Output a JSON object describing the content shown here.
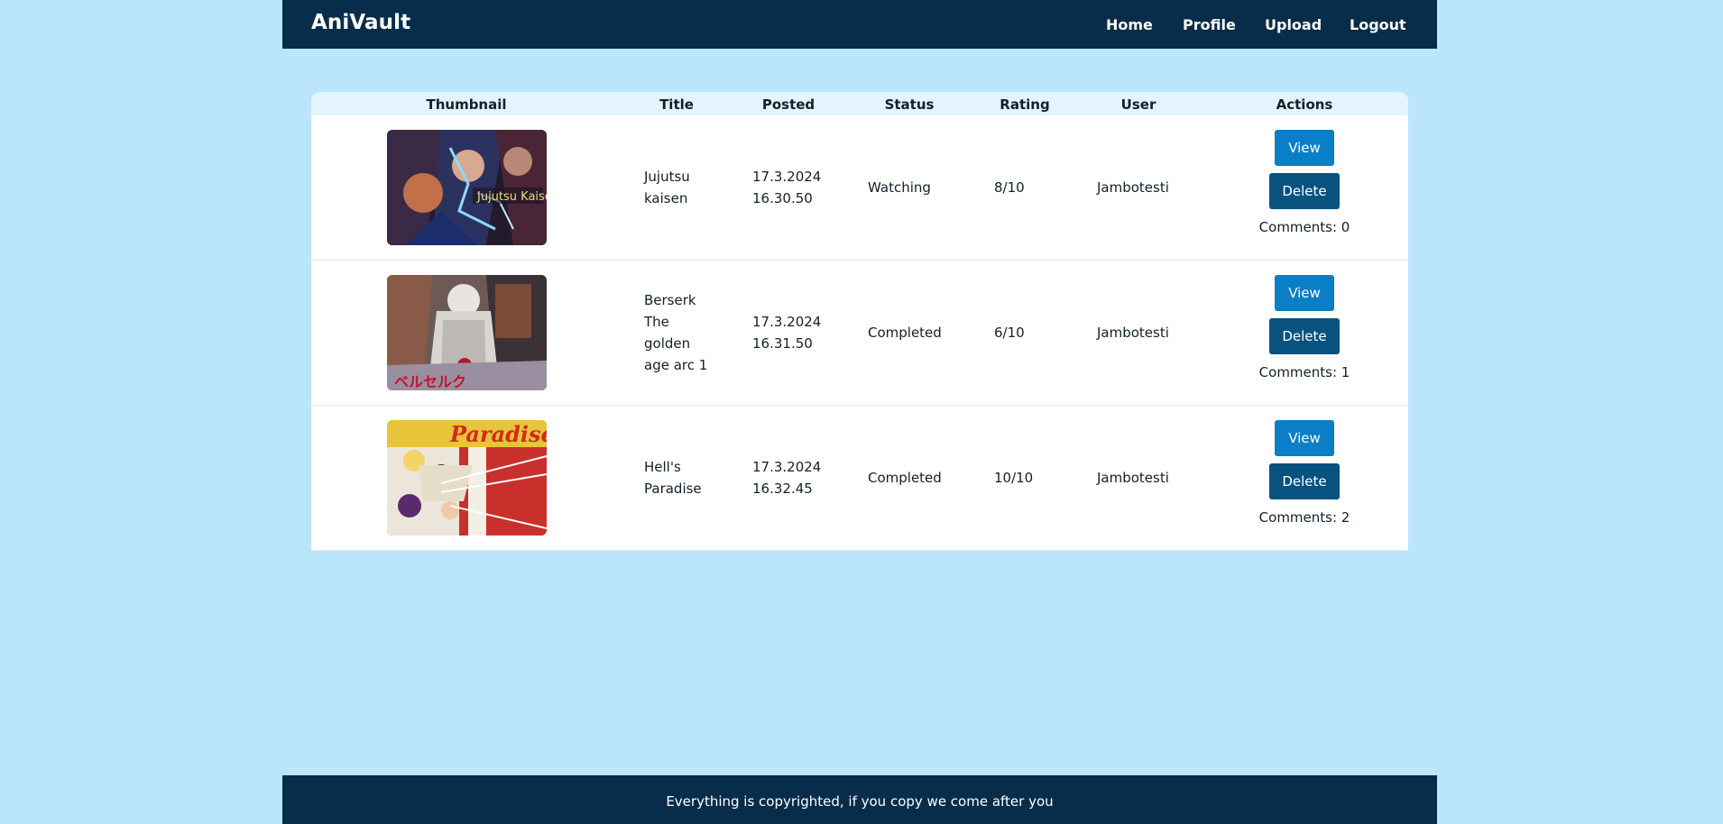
{
  "app": {
    "brand": "AniVault"
  },
  "nav": {
    "home": "Home",
    "profile": "Profile",
    "upload": "Upload",
    "logout": "Logout"
  },
  "table": {
    "headers": [
      "Thumbnail",
      "Title",
      "Posted",
      "Status",
      "Rating",
      "User",
      "Actions"
    ],
    "rows": [
      {
        "title_lines": [
          "Jujutsu",
          "kaisen"
        ],
        "posted_lines": [
          "17.3.2024",
          "16.30.50"
        ],
        "status": "Watching",
        "rating": "8/10",
        "user": "Jambotesti",
        "view_label": "View",
        "delete_label": "Delete",
        "comments": "Comments: 0"
      },
      {
        "title_lines": [
          "Berserk",
          "The",
          "golden",
          "age arc 1"
        ],
        "posted_lines": [
          "17.3.2024",
          "16.31.50"
        ],
        "status": "Completed",
        "rating": "6/10",
        "user": "Jambotesti",
        "view_label": "View",
        "delete_label": "Delete",
        "comments": "Comments: 1"
      },
      {
        "title_lines": [
          "Hell's",
          "Paradise"
        ],
        "posted_lines": [
          "17.3.2024",
          "16.32.45"
        ],
        "status": "Completed",
        "rating": "10/10",
        "user": "Jambotesti",
        "view_label": "View",
        "delete_label": "Delete",
        "comments": "Comments: 2"
      }
    ]
  },
  "footer": {
    "text": "Everything is copyrighted, if you copy we come after you"
  },
  "colors": {
    "background": "#bbe5fb",
    "navbar": "#082d4a",
    "view_button": "#0a7ec6",
    "delete_button": "#07527f",
    "table_header": "#e4f3fd"
  }
}
